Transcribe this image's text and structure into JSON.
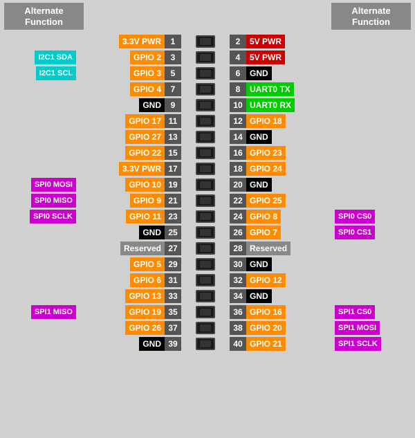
{
  "header": {
    "left_title": "Alternate\nFunction",
    "right_title": "Alternate\nFunction"
  },
  "pins": [
    {
      "left_alt": "",
      "left_label": "3.3V PWR",
      "left_color": "color-3v3",
      "left_num": 1,
      "right_num": 2,
      "right_label": "5V PWR",
      "right_color": "color-5v",
      "right_alt": ""
    },
    {
      "left_alt": "I2C1 SDA",
      "left_label": "GPIO 2",
      "left_color": "color-gpio",
      "left_num": 3,
      "right_num": 4,
      "right_label": "5V PWR",
      "right_color": "color-5v",
      "right_alt": ""
    },
    {
      "left_alt": "I2C1 SCL",
      "left_label": "GPIO 3",
      "left_color": "color-gpio",
      "left_num": 5,
      "right_num": 6,
      "right_label": "GND",
      "right_color": "color-gnd",
      "right_alt": ""
    },
    {
      "left_alt": "",
      "left_label": "GPIO 4",
      "left_color": "color-gpio",
      "left_num": 7,
      "right_num": 8,
      "right_label": "UART0 TX",
      "right_color": "color-uart-tx",
      "right_alt": ""
    },
    {
      "left_alt": "",
      "left_label": "GND",
      "left_color": "color-gnd",
      "left_num": 9,
      "right_num": 10,
      "right_label": "UART0 RX",
      "right_color": "color-uart-rx",
      "right_alt": ""
    },
    {
      "left_alt": "",
      "left_label": "GPIO 17",
      "left_color": "color-gpio",
      "left_num": 11,
      "right_num": 12,
      "right_label": "GPIO 18",
      "right_color": "color-gpio",
      "right_alt": ""
    },
    {
      "left_alt": "",
      "left_label": "GPIO 27",
      "left_color": "color-gpio",
      "left_num": 13,
      "right_num": 14,
      "right_label": "GND",
      "right_color": "color-gnd",
      "right_alt": ""
    },
    {
      "left_alt": "",
      "left_label": "GPIO 22",
      "left_color": "color-gpio",
      "left_num": 15,
      "right_num": 16,
      "right_label": "GPIO 23",
      "right_color": "color-gpio",
      "right_alt": ""
    },
    {
      "left_alt": "",
      "left_label": "3.3V PWR",
      "left_color": "color-3v3",
      "left_num": 17,
      "right_num": 18,
      "right_label": "GPIO 24",
      "right_color": "color-gpio",
      "right_alt": ""
    },
    {
      "left_alt": "SPI0 MOSI",
      "left_label": "GPIO 10",
      "left_color": "color-gpio",
      "left_num": 19,
      "right_num": 20,
      "right_label": "GND",
      "right_color": "color-gnd",
      "right_alt": ""
    },
    {
      "left_alt": "SPI0 MISO",
      "left_label": "GPIO 9",
      "left_color": "color-gpio",
      "left_num": 21,
      "right_num": 22,
      "right_label": "GPIO 25",
      "right_color": "color-gpio",
      "right_alt": ""
    },
    {
      "left_alt": "SPI0 SCLK",
      "left_label": "GPIO 11",
      "left_color": "color-gpio",
      "left_num": 23,
      "right_num": 24,
      "right_label": "GPIO 8",
      "right_color": "color-gpio",
      "right_alt": "SPI0 CS0"
    },
    {
      "left_alt": "",
      "left_label": "GND",
      "left_color": "color-gnd",
      "left_num": 25,
      "right_num": 26,
      "right_label": "GPIO 7",
      "right_color": "color-gpio",
      "right_alt": "SPI0 CS1"
    },
    {
      "left_alt": "",
      "left_label": "Reserved",
      "left_color": "color-reserved",
      "left_num": 27,
      "right_num": 28,
      "right_label": "Reserved",
      "right_color": "color-reserved",
      "right_alt": ""
    },
    {
      "left_alt": "",
      "left_label": "GPIO 5",
      "left_color": "color-gpio",
      "left_num": 29,
      "right_num": 30,
      "right_label": "GND",
      "right_color": "color-gnd",
      "right_alt": ""
    },
    {
      "left_alt": "",
      "left_label": "GPIO 6",
      "left_color": "color-gpio",
      "left_num": 31,
      "right_num": 32,
      "right_label": "GPIO 12",
      "right_color": "color-gpio",
      "right_alt": ""
    },
    {
      "left_alt": "",
      "left_label": "GPIO 13",
      "left_color": "color-gpio",
      "left_num": 33,
      "right_num": 34,
      "right_label": "GND",
      "right_color": "color-gnd",
      "right_alt": ""
    },
    {
      "left_alt": "SPI1 MISO",
      "left_label": "GPIO 19",
      "left_color": "color-gpio",
      "left_num": 35,
      "right_num": 36,
      "right_label": "GPIO 16",
      "right_color": "color-gpio",
      "right_alt": "SPI1 CS0"
    },
    {
      "left_alt": "",
      "left_label": "GPIO 26",
      "left_color": "color-gpio",
      "left_num": 37,
      "right_num": 38,
      "right_label": "GPIO 20",
      "right_color": "color-gpio",
      "right_alt": "SPI1 MOSI"
    },
    {
      "left_alt": "",
      "left_label": "GND",
      "left_color": "color-gnd",
      "left_num": 39,
      "right_num": 40,
      "right_label": "GPIO 21",
      "right_color": "color-gpio",
      "right_alt": "SPI1 SCLK"
    }
  ]
}
